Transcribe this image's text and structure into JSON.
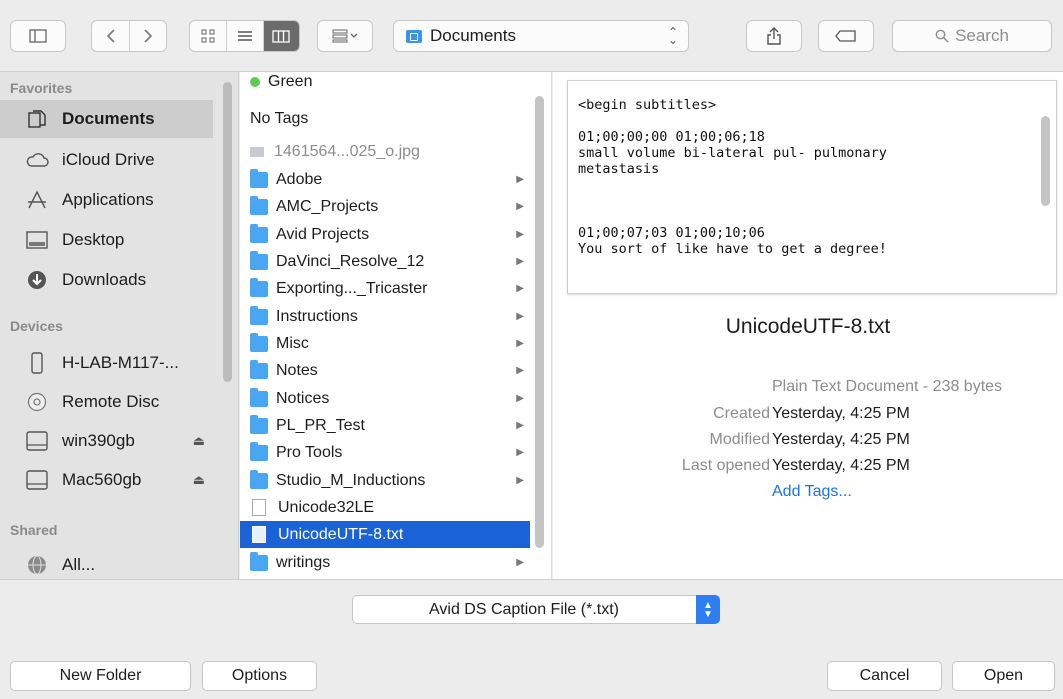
{
  "toolbar": {
    "location": "Documents",
    "search_placeholder": "Search"
  },
  "sidebar": {
    "favorites_header": "Favorites",
    "favorites": [
      "Documents",
      "iCloud Drive",
      "Applications",
      "Desktop",
      "Downloads"
    ],
    "devices_header": "Devices",
    "devices": [
      "H-LAB-M117-...",
      "Remote Disc",
      "win390gb",
      "Mac560gb"
    ],
    "shared_header": "Shared",
    "shared": [
      "All..."
    ]
  },
  "column": {
    "tag_green": "Green",
    "no_tags": "No Tags",
    "items": [
      {
        "name": "1461564...025_o.jpg",
        "kind": "image"
      },
      {
        "name": "Adobe",
        "kind": "folder"
      },
      {
        "name": "AMC_Projects",
        "kind": "folder"
      },
      {
        "name": "Avid Projects",
        "kind": "folder"
      },
      {
        "name": "DaVinci_Resolve_12",
        "kind": "folder"
      },
      {
        "name": "Exporting..._Tricaster",
        "kind": "folder"
      },
      {
        "name": "Instructions",
        "kind": "folder"
      },
      {
        "name": "Misc",
        "kind": "folder"
      },
      {
        "name": "Notes",
        "kind": "folder"
      },
      {
        "name": "Notices",
        "kind": "folder"
      },
      {
        "name": "PL_PR_Test",
        "kind": "folder"
      },
      {
        "name": "Pro Tools",
        "kind": "folder"
      },
      {
        "name": "Studio_M_Inductions",
        "kind": "folder"
      },
      {
        "name": "Unicode32LE",
        "kind": "doc"
      },
      {
        "name": "UnicodeUTF-8.txt",
        "kind": "doc",
        "selected": true
      },
      {
        "name": "writings",
        "kind": "folder"
      }
    ]
  },
  "preview": {
    "content": "<begin subtitles>\n\n01;00;00;00 01;00;06;18\nsmall volume bi-lateral pul- pulmonary\nmetastasis\n\n\n\n01;00;07;03 01;00;10;06\nYou sort of like have to get a degree!",
    "filename": "UnicodeUTF-8.txt",
    "kind": "Plain Text Document - 238 bytes",
    "created_label": "Created",
    "created_value": "Yesterday, 4:25 PM",
    "modified_label": "Modified",
    "modified_value": "Yesterday, 4:25 PM",
    "opened_label": "Last opened",
    "opened_value": "Yesterday, 4:25 PM",
    "add_tags": "Add Tags..."
  },
  "bottom": {
    "format": "Avid DS Caption File (*.txt)",
    "new_folder": "New Folder",
    "options": "Options",
    "cancel": "Cancel",
    "open": "Open"
  },
  "colors": {
    "selection": "#1a63d6",
    "folder": "#4aa6f2",
    "tag_green": "#5ecb55",
    "link": "#1b74e4"
  }
}
